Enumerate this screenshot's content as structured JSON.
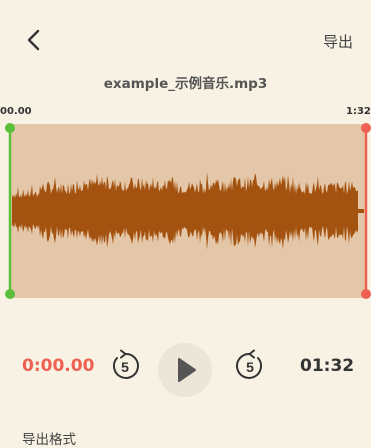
{
  "header": {
    "export_label": "导出"
  },
  "file": {
    "name": "example_示例音乐.mp3"
  },
  "timeline": {
    "start_label": "00.00",
    "end_label": "1:32."
  },
  "player": {
    "current_time": "0:00.00",
    "total_time": "01:32",
    "rewind_seconds": "5",
    "forward_seconds": "5"
  },
  "section": {
    "format_label": "导出格式"
  },
  "colors": {
    "background": "#f7f2e4",
    "waveform_bg": "#e4c7a8",
    "waveform": "#a3520f",
    "start_handle": "#5cbf3a",
    "end_handle": "#ee6152",
    "current_time": "#ee6152"
  }
}
